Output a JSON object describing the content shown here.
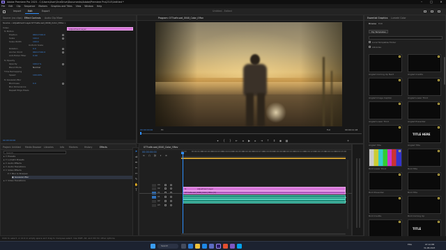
{
  "window": {
    "title": "Adobe Premiere Pro 2023 - C:\\Users\\User\\OneDrive\\Documents\\Adobe\\Premiere Pro\\23.0\\Untitled *",
    "controls": [
      "–",
      "□",
      "✕"
    ]
  },
  "menu": [
    "File",
    "Edit",
    "Clip",
    "Sequence",
    "Markers",
    "Graphics and Titles",
    "View",
    "Window",
    "Help"
  ],
  "workspaces": {
    "items": [
      "Import",
      "Edit",
      "Export"
    ],
    "active": "Edit",
    "center_title": "Untitled - Edited"
  },
  "source_panel": {
    "tabs": [
      "Source: (no clips)",
      "Effect Controls",
      "Audio Clip Mixer"
    ],
    "active_tab": "Effect Controls",
    "header_left": "Source • Adjustment Layer",
    "header_right": "077cafe-sad_0040_Color_f.Mov • Adjustment...",
    "clip_label": "Adjustment Layer",
    "timecode": "00:00:00:00",
    "props": [
      {
        "label": "Video",
        "value": ""
      },
      {
        "label": "fx  Motion",
        "value": ""
      },
      {
        "label": "Position",
        "value": "960.0   540.0"
      },
      {
        "label": "Scale",
        "value": "100.0"
      },
      {
        "label": "Scale Width",
        "value": "100.0"
      },
      {
        "label": "",
        "value": "Uniform Scale"
      },
      {
        "label": "Rotation",
        "value": "0.0"
      },
      {
        "label": "Anchor Point",
        "value": "960.0   540.0"
      },
      {
        "label": "Anti-flicker Filter",
        "value": "0.00"
      },
      {
        "label": "fx  Opacity",
        "value": ""
      },
      {
        "label": "Opacity",
        "value": "100.0 %"
      },
      {
        "label": "Blend Mode",
        "value": "Normal"
      },
      {
        "label": "Time Remapping",
        "value": ""
      },
      {
        "label": "Speed",
        "value": "100.00%"
      },
      {
        "label": "fx  Gaussian Blur",
        "value": ""
      },
      {
        "label": "Blurriness",
        "value": "0.0"
      },
      {
        "label": "Blur Dimensions",
        "value": "Horizontal and Vertical"
      },
      {
        "label": "Repeat Edge Pixels",
        "value": ""
      }
    ]
  },
  "program": {
    "title": "Program: 077cafe-sad_0040_Color_f.Mov",
    "timecode_left": "00:00:00:00",
    "fit": "Fit",
    "quality": "Full",
    "timecode_right": "00:00:11:18"
  },
  "project_panel": {
    "tabs": [
      "Project: Untitled",
      "Media Browser",
      "Libraries",
      "Info",
      "Markers",
      "History",
      "Effects"
    ],
    "active_tab": "Effects",
    "search_placeholder": "Search",
    "items": [
      "Presets",
      "Lumetri Presets",
      "Audio Effects",
      "Audio Transitions",
      "Video Effects",
      "Blur & Sharpen",
      "Gaussian Blur",
      "Video Transitions"
    ]
  },
  "timeline": {
    "title": "077cafe-sad_0040_Color_f.Mov",
    "timecode": "00:00:00:00",
    "ruler": [
      "00:00",
      "00:00:01:00",
      "00:00:02:00",
      "00:00:03:00",
      "00:00:04:00",
      "00:00:05:00",
      "00:00:06:00",
      "00:00:07:00",
      "00:00:08:00",
      "00:00:09:00",
      "00:00:10:00",
      "00:00:11:00",
      "00:00:12:00",
      "00:00:13:00",
      "00:00:14:00",
      "00:00:15:00"
    ],
    "tracks": [
      {
        "name": "V3"
      },
      {
        "name": "V2"
      },
      {
        "name": "V1"
      },
      {
        "name": "A1"
      },
      {
        "name": "A2"
      },
      {
        "name": "A3"
      }
    ],
    "clips": {
      "adjustment": "Adjustment Layer",
      "video": "077cafe-sad_0040_Color_f.Mov [V]"
    }
  },
  "essential_graphics": {
    "tabs": [
      "Essential Graphics",
      "Lumetri Color"
    ],
    "browse": "Browse",
    "edit": "Edit",
    "my_templates": "My Templates",
    "checkbox1": "Local Templates Folder",
    "checkbox2": "Libraries",
    "templates": [
      "Angled Coming Up Next",
      "Angled Credits",
      "Angled Image Caption",
      "Angled Lower Third",
      "Angled Lower Third",
      "Angled Presenter",
      "Angled Title",
      "Angled Title",
      "Bold Lower Third",
      "Bold Title",
      "Bold Presenter",
      "Bold Title",
      "Bold Credits",
      "Bold Coming Up",
      "Bold Caption",
      "Bold Title"
    ],
    "thumb_texts": [
      "",
      "",
      "",
      "",
      "",
      "",
      "",
      "TITLE HERE",
      "",
      "",
      "",
      "",
      "",
      "",
      "",
      "TITLE"
    ]
  },
  "status_bar": "Click to select, or click in empty space and drag to marquee select. Use Shift, Alt, and Ctrl for other options.",
  "taskbar": {
    "search": "Search",
    "time": "07:14 PM",
    "date": "31-08-2023",
    "lang": "ENG"
  },
  "colors": {
    "accent": "#2e8fff",
    "adjustment_clip": "#d776d9",
    "audio_clip": "#1d8b79",
    "playhead": "#2e8fff"
  }
}
